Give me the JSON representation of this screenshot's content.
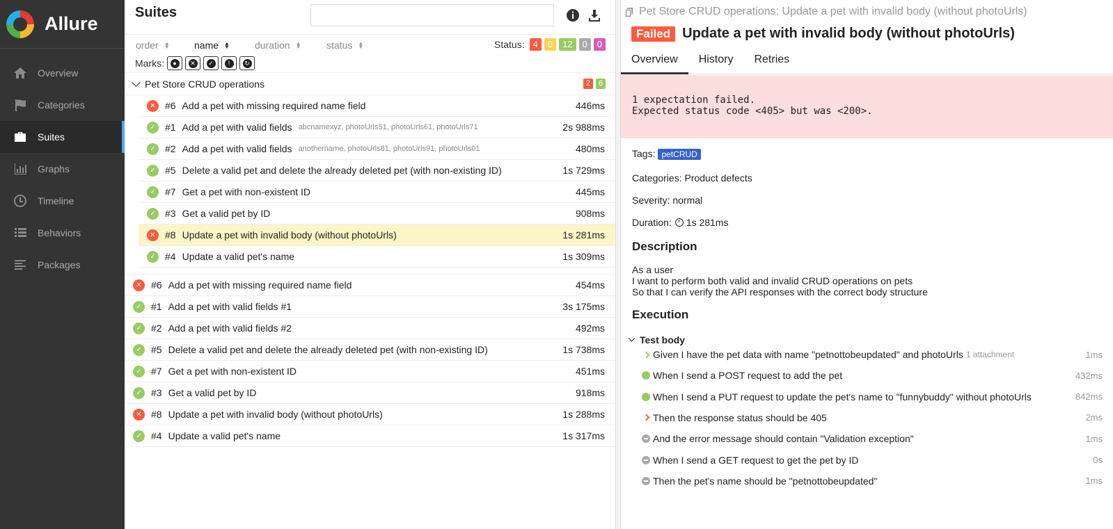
{
  "app": {
    "name": "Allure"
  },
  "sidebar": {
    "items": [
      {
        "label": "Overview",
        "icon": "home-icon"
      },
      {
        "label": "Categories",
        "icon": "flag-icon"
      },
      {
        "label": "Suites",
        "icon": "briefcase-icon",
        "active": true
      },
      {
        "label": "Graphs",
        "icon": "bar-chart-icon"
      },
      {
        "label": "Timeline",
        "icon": "clock-icon"
      },
      {
        "label": "Behaviors",
        "icon": "list-icon"
      },
      {
        "label": "Packages",
        "icon": "align-left-icon"
      }
    ]
  },
  "suites": {
    "title": "Suites",
    "search": {
      "value": "",
      "placeholder": ""
    },
    "sort": {
      "order": "order",
      "name": "name",
      "duration": "duration",
      "status": "status"
    },
    "status_label": "Status:",
    "counts": {
      "failed": "4",
      "broken": "0",
      "passed": "12",
      "skipped": "0",
      "unknown": "0"
    },
    "marks_label": "Marks:",
    "group": {
      "name": "Pet Store CRUD operations",
      "failed": "2",
      "passed": "6",
      "rows": [
        {
          "status": "failed",
          "num": "#6",
          "name": "Add a pet with missing required name field",
          "params": "",
          "duration": "446ms"
        },
        {
          "status": "passed",
          "num": "#1",
          "name": "Add a pet with valid fields",
          "params": "abcnamexyz, photoUrls51, photoUrls61, photoUrls71",
          "duration": "2s 988ms"
        },
        {
          "status": "passed",
          "num": "#2",
          "name": "Add a pet with valid fields",
          "params": "anothername, photoUrls81, photoUrls91, photoUrls01",
          "duration": "480ms"
        },
        {
          "status": "passed",
          "num": "#5",
          "name": "Delete a valid pet and delete the already deleted pet (with non-existing ID)",
          "params": "",
          "duration": "1s 729ms"
        },
        {
          "status": "passed",
          "num": "#7",
          "name": "Get a pet with non-existent ID",
          "params": "",
          "duration": "445ms"
        },
        {
          "status": "passed",
          "num": "#3",
          "name": "Get a valid pet by ID",
          "params": "",
          "duration": "908ms"
        },
        {
          "status": "failed",
          "num": "#8",
          "name": "Update a pet with invalid body (without photoUrls)",
          "params": "",
          "duration": "1s 281ms",
          "selected": true
        },
        {
          "status": "passed",
          "num": "#4",
          "name": "Update a valid pet's name",
          "params": "",
          "duration": "1s 309ms"
        }
      ]
    },
    "rows": [
      {
        "status": "failed",
        "num": "#6",
        "name": "Add a pet with missing required name field",
        "duration": "454ms"
      },
      {
        "status": "passed",
        "num": "#1",
        "name": "Add a pet with valid fields #1",
        "duration": "3s 175ms"
      },
      {
        "status": "passed",
        "num": "#2",
        "name": "Add a pet with valid fields #2",
        "duration": "492ms"
      },
      {
        "status": "passed",
        "num": "#5",
        "name": "Delete a valid pet and delete the already deleted pet (with non-existing ID)",
        "duration": "1s 738ms"
      },
      {
        "status": "passed",
        "num": "#7",
        "name": "Get a pet with non-existent ID",
        "duration": "451ms"
      },
      {
        "status": "passed",
        "num": "#3",
        "name": "Get a valid pet by ID",
        "duration": "918ms"
      },
      {
        "status": "failed",
        "num": "#8",
        "name": "Update a pet with invalid body (without photoUrls)",
        "duration": "1s 288ms"
      },
      {
        "status": "passed",
        "num": "#4",
        "name": "Update a valid pet's name",
        "duration": "1s 317ms"
      }
    ]
  },
  "detail": {
    "breadcrumb": "Pet Store CRUD operations: Update a pet with invalid body (without photoUrls)",
    "status_badge": "Failed",
    "title": "Update a pet with invalid body (without photoUrls)",
    "tabs": [
      "Overview",
      "History",
      "Retries"
    ],
    "error_line1": "1 expectation failed.",
    "error_line2": "Expected status code <405> but was <200>.",
    "tags_label": "Tags:",
    "tag": "petCRUD",
    "categories": "Categories: Product defects",
    "severity": "Severity: normal",
    "duration_label": "Duration:",
    "duration": "1s 281ms",
    "description_title": "Description",
    "description": [
      "As a user",
      "I want to perform both valid and invalid CRUD operations on pets",
      "So that I can verify the API responses with the correct body structure"
    ],
    "execution_title": "Execution",
    "test_body_label": "Test body",
    "steps": [
      {
        "type": "arrow-green",
        "text": "Given I have the pet data with name \"petnottobeupdated\" and photoUrls",
        "extra": "1 attachment",
        "duration": "1ms"
      },
      {
        "type": "passed",
        "text": "When I send a POST request to add the pet",
        "extra": "",
        "duration": "432ms"
      },
      {
        "type": "passed",
        "text": "When I send a PUT request to update the pet's name to \"funnybuddy\" without photoUrls",
        "extra": "",
        "duration": "842ms"
      },
      {
        "type": "arrow-red",
        "text": "Then the response status should be 405",
        "extra": "",
        "duration": "2ms"
      },
      {
        "type": "skipped",
        "text": "And the error message should contain \"Validation exception\"",
        "extra": "",
        "duration": "1ms"
      },
      {
        "type": "skipped",
        "text": "When I send a GET request to get the pet by ID",
        "extra": "",
        "duration": "0s"
      },
      {
        "type": "skipped",
        "text": "Then the pet's name should be \"petnottobeupdated\"",
        "extra": "",
        "duration": "1ms"
      }
    ]
  },
  "colors": {
    "failed": "#fd5a3e",
    "passed": "#97cc64",
    "broken": "#ffd050",
    "skipped": "#aaaaaa",
    "unknown": "#d35ebe",
    "accent": "#4ea6f1",
    "tag": "#3561cc"
  }
}
